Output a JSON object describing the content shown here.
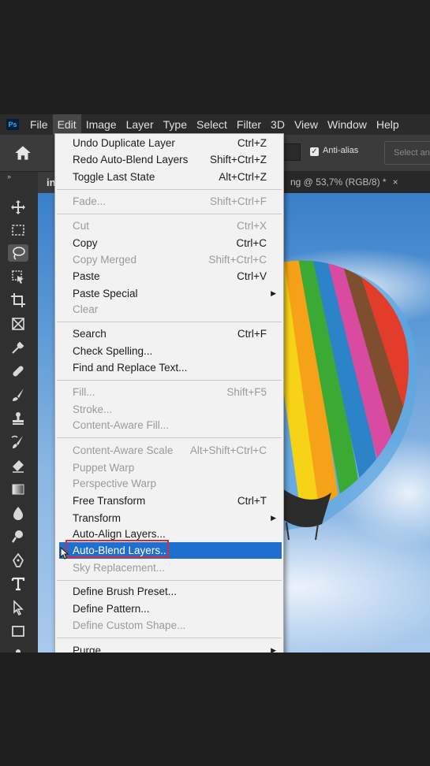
{
  "app": {
    "logo_text": "Ps"
  },
  "menubar": {
    "items": [
      "File",
      "Edit",
      "Image",
      "Layer",
      "Type",
      "Select",
      "Filter",
      "3D",
      "View",
      "Window",
      "Help"
    ]
  },
  "options": {
    "antialias_label": "Anti-alias",
    "select_button": "Select an"
  },
  "tabs": {
    "left_label": "in",
    "right_label": "ng @ 53,7% (RGB/8) *",
    "close": "×"
  },
  "edit_menu": {
    "items": [
      {
        "label": "Undo Duplicate Layer",
        "shortcut": "Ctrl+Z"
      },
      {
        "label": "Redo Auto-Blend Layers",
        "shortcut": "Shift+Ctrl+Z"
      },
      {
        "label": "Toggle Last State",
        "shortcut": "Alt+Ctrl+Z"
      },
      {
        "label": "Fade...",
        "shortcut": "Shift+Ctrl+F",
        "disabled": true
      },
      {
        "label": "Cut",
        "shortcut": "Ctrl+X",
        "disabled": true
      },
      {
        "label": "Copy",
        "shortcut": "Ctrl+C"
      },
      {
        "label": "Copy Merged",
        "shortcut": "Shift+Ctrl+C",
        "disabled": true
      },
      {
        "label": "Paste",
        "shortcut": "Ctrl+V"
      },
      {
        "label": "Paste Special",
        "submenu": true
      },
      {
        "label": "Clear",
        "disabled": true
      },
      {
        "label": "Search",
        "shortcut": "Ctrl+F"
      },
      {
        "label": "Check Spelling..."
      },
      {
        "label": "Find and Replace Text..."
      },
      {
        "label": "Fill...",
        "shortcut": "Shift+F5",
        "disabled": true
      },
      {
        "label": "Stroke...",
        "disabled": true
      },
      {
        "label": "Content-Aware Fill...",
        "disabled": true
      },
      {
        "label": "Content-Aware Scale",
        "shortcut": "Alt+Shift+Ctrl+C",
        "disabled": true
      },
      {
        "label": "Puppet Warp",
        "disabled": true
      },
      {
        "label": "Perspective Warp",
        "disabled": true
      },
      {
        "label": "Free Transform",
        "shortcut": "Ctrl+T"
      },
      {
        "label": "Transform",
        "submenu": true
      },
      {
        "label": "Auto-Align Layers..."
      },
      {
        "label": "Auto-Blend Layers...",
        "highlighted": true
      },
      {
        "label": "Sky Replacement...",
        "disabled": true
      },
      {
        "label": "Define Brush Preset..."
      },
      {
        "label": "Define Pattern..."
      },
      {
        "label": "Define Custom Shape...",
        "disabled": true
      },
      {
        "label": "Purge",
        "submenu": true
      }
    ]
  },
  "colors": {
    "menu_highlight": "#1f6fd1",
    "highlight_outline": "#cf2e3b"
  }
}
